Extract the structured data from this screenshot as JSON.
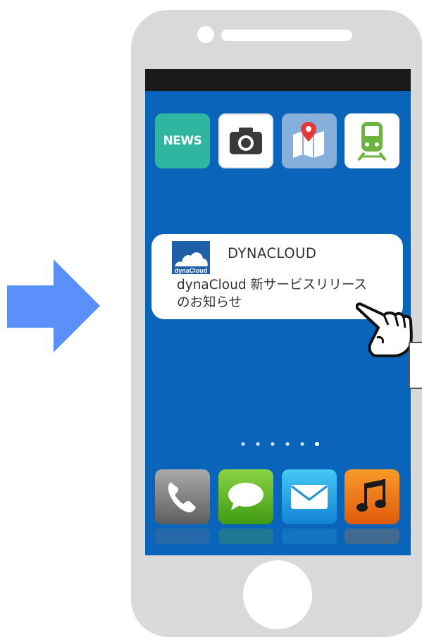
{
  "home_screen": {
    "top_apps": [
      {
        "name": "News",
        "label": "NEWS",
        "icon": "news-icon",
        "color": "#2fb5a0"
      },
      {
        "name": "Camera",
        "icon": "camera-icon",
        "color": "#ffffff"
      },
      {
        "name": "Map",
        "icon": "map-pin-icon",
        "color": "#86b0db"
      },
      {
        "name": "Train",
        "icon": "train-icon",
        "color": "#ffffff"
      }
    ],
    "dock_apps": [
      {
        "name": "Phone",
        "icon": "phone-handset-icon"
      },
      {
        "name": "Messages",
        "icon": "speech-bubble-icon"
      },
      {
        "name": "Mail",
        "icon": "envelope-icon"
      },
      {
        "name": "Music",
        "icon": "music-note-icon"
      }
    ],
    "page_indicator": {
      "page_count": 6
    },
    "background_color": "#0a64b9"
  },
  "notification": {
    "logo_text": "dynaCloud",
    "sender": "DYNACLOUD",
    "message_line1": "dynaCloud 新サービスリリース",
    "message_line2": "のお知らせ"
  },
  "decor": {
    "arrow_icon": "right-arrow-icon",
    "arrow_color": "#5b8ff9",
    "hand_icon": "pointing-hand-icon"
  }
}
